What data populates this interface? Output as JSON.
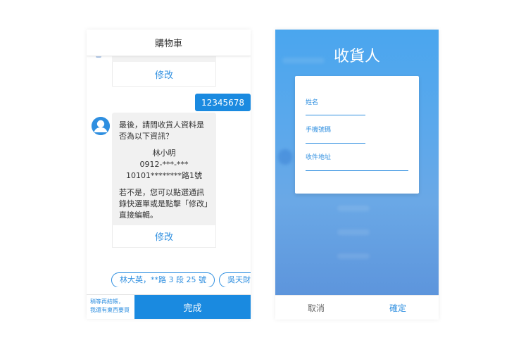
{
  "cart": {
    "title": "購物車",
    "edit_top_label": "修改",
    "user_message": "12345678",
    "bot_message": {
      "question": "最後，請問收貨人資料是否為以下資訊？",
      "name": "林小明",
      "phone": "0912-***-***",
      "address": "10101********路1號",
      "hint": "若不是，您可以點選通訊錄快選單或是點擊「修改」直接編輯。"
    },
    "edit_label": "修改",
    "chips": [
      "林大英，**路 3 段 25 號",
      "吳天財，**"
    ],
    "footer_note_line1": "稍等再結帳，",
    "footer_note_line2": "我還有東西要買",
    "complete_label": "完成"
  },
  "recipient": {
    "title": "收貨人",
    "name_label": "姓名",
    "phone_label": "手機號碼",
    "address_label": "收件地址",
    "cancel_label": "取消",
    "confirm_label": "確定"
  },
  "colors": {
    "accent": "#1a8ae0",
    "accent_text": "#2f8fe0"
  }
}
